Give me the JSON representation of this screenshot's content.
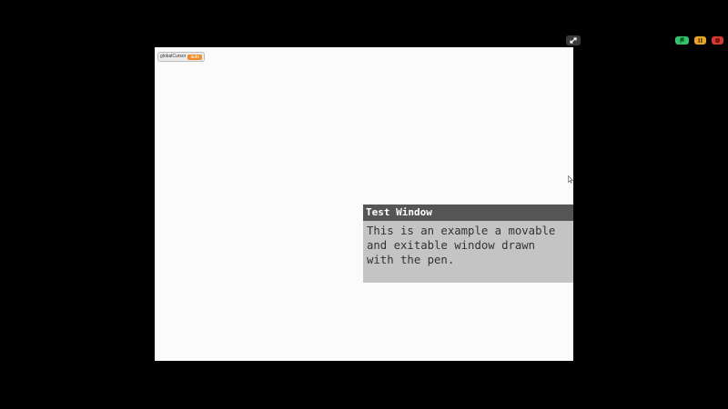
{
  "controls": {
    "fullscreen_icon": "fullscreen-arrows-icon",
    "green_flag_icon": "green-flag-icon",
    "pause_icon": "pause-icon",
    "stop_icon": "stop-icon",
    "colors": {
      "green_flag": "#35c26a",
      "pause": "#e8a425",
      "stop": "#d33a2e"
    }
  },
  "stage": {
    "variable_monitor": {
      "name": "globalCursor",
      "value": "auto",
      "color": "#f18b24"
    },
    "window": {
      "title": "Test Window",
      "body_lines": [
        "This is an example a movable",
        "and exitable window drawn",
        "with the pen."
      ],
      "title_color": "#555555",
      "body_color": "#c4c4c4"
    }
  }
}
